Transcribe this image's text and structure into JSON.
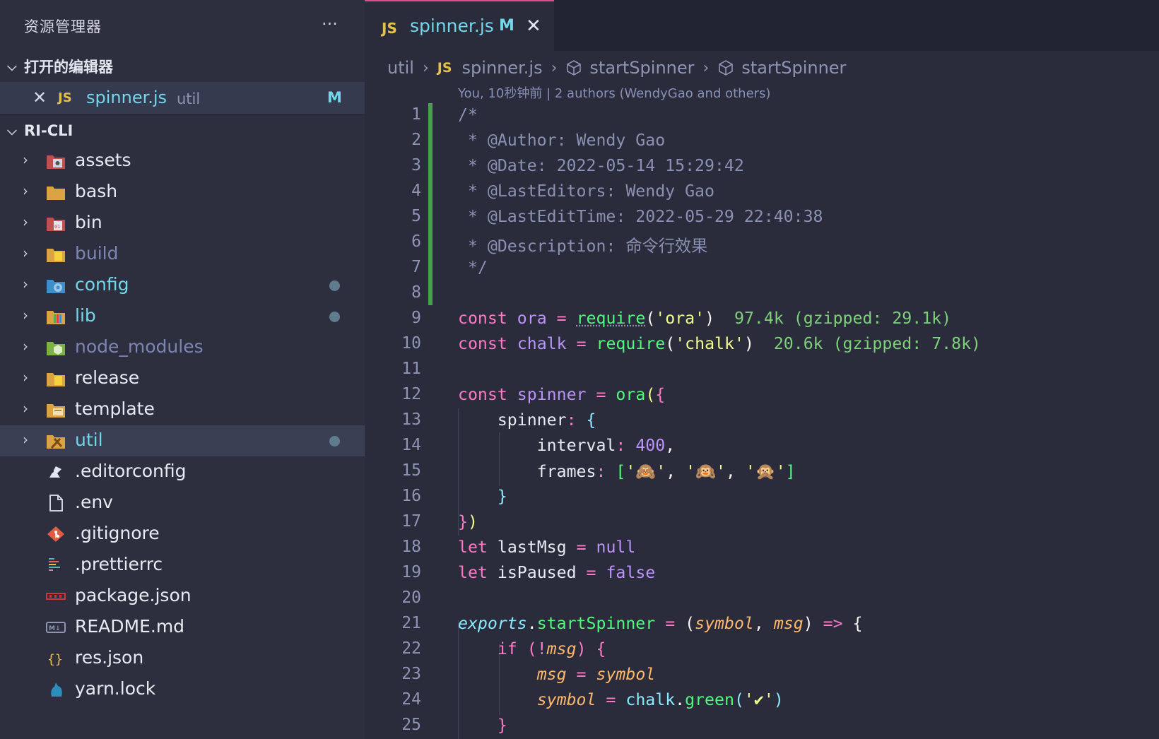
{
  "sidebar": {
    "title": "资源管理器",
    "more": "···",
    "open_editors": {
      "header": "打开的编辑器",
      "items": [
        {
          "close": "✕",
          "badge": "JS",
          "name": "spinner.js",
          "dir": "util",
          "status": "M"
        }
      ]
    },
    "project": {
      "header": "RI-CLI",
      "items": [
        {
          "name": "assets",
          "type": "folder"
        },
        {
          "name": "bash",
          "type": "folder"
        },
        {
          "name": "bin",
          "type": "folder"
        },
        {
          "name": "build",
          "type": "folder"
        },
        {
          "name": "config",
          "type": "folder",
          "modified": true
        },
        {
          "name": "lib",
          "type": "folder",
          "modified": true
        },
        {
          "name": "node_modules",
          "type": "folder"
        },
        {
          "name": "release",
          "type": "folder"
        },
        {
          "name": "template",
          "type": "folder"
        },
        {
          "name": "util",
          "type": "folder",
          "modified": true,
          "selected": true
        },
        {
          "name": ".editorconfig",
          "type": "file"
        },
        {
          "name": ".env",
          "type": "file"
        },
        {
          "name": ".gitignore",
          "type": "file"
        },
        {
          "name": ".prettierrc",
          "type": "file"
        },
        {
          "name": "package.json",
          "type": "file"
        },
        {
          "name": "README.md",
          "type": "file"
        },
        {
          "name": "res.json",
          "type": "file"
        },
        {
          "name": "yarn.lock",
          "type": "file"
        }
      ]
    }
  },
  "editor": {
    "tab": {
      "badge": "JS",
      "name": "spinner.js",
      "status": "M",
      "close": "✕"
    },
    "breadcrumb": [
      "util",
      "spinner.js",
      "startSpinner",
      "startSpinner"
    ],
    "blame": "You, 10秒钟前 | 2 authors (WendyGao and others)",
    "line_numbers": [
      "1",
      "2",
      "3",
      "4",
      "5",
      "6",
      "7",
      "8",
      "9",
      "10",
      "11",
      "12",
      "13",
      "14",
      "15",
      "16",
      "17",
      "18",
      "19",
      "20",
      "21",
      "22",
      "23",
      "24",
      "25"
    ],
    "code": {
      "l1": "/*",
      "l2": " * @Author: Wendy Gao",
      "l3": " * @Date: 2022-05-14 15:29:42",
      "l4": " * @LastEditors: Wendy Gao",
      "l5": " * @LastEditTime: 2022-05-29 22:40:38",
      "l6": " * @Description: 命令行效果",
      "l7": " */",
      "import_size_1": "97.4k (gzipped: 29.1k)",
      "import_size_2": "20.6k (gzipped: 7.8k)",
      "frames": [
        "🙈",
        "🙉",
        "🙊"
      ]
    }
  },
  "colors": {
    "accent_tab": "#e04f8b",
    "git_added": "#47a04a",
    "modified_dot": "#5f7c8e",
    "js_badge": "#e4c04a"
  }
}
